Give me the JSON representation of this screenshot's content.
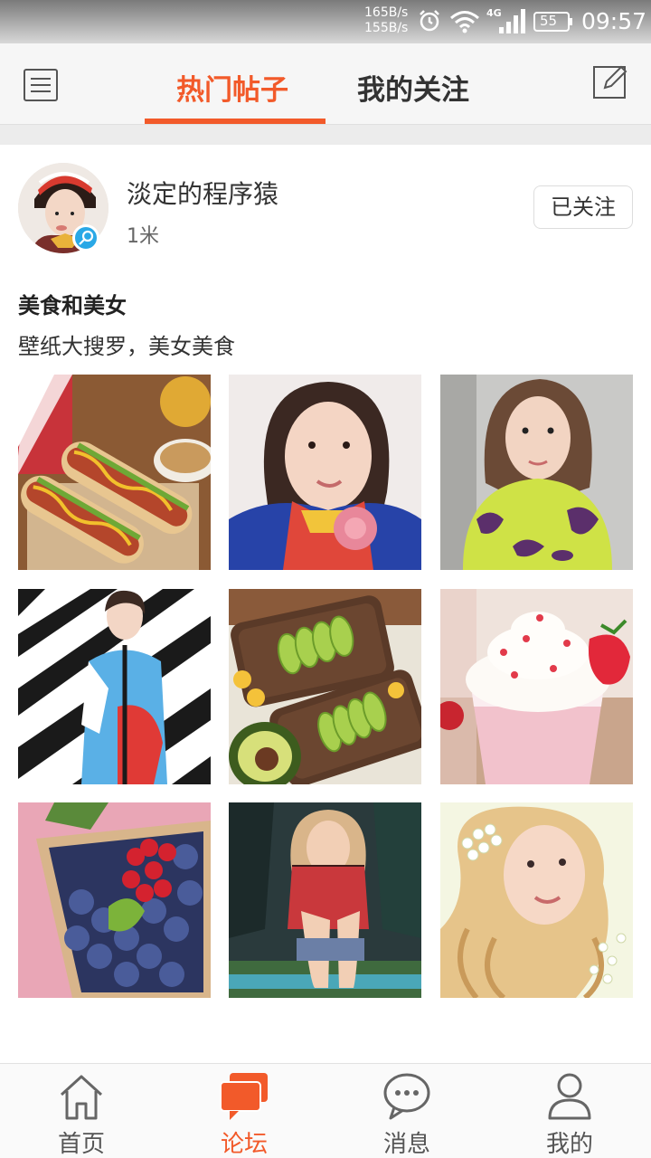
{
  "status_bar": {
    "net_up": "165B/s",
    "net_down": "155B/s",
    "network": "4G",
    "battery": "55",
    "time": "09:57"
  },
  "header": {
    "tabs": [
      {
        "label": "热门帖子",
        "active": true
      },
      {
        "label": "我的关注",
        "active": false
      }
    ],
    "accent_color": "#f25a2a"
  },
  "post": {
    "username": "淡定的程序猿",
    "distance": "1米",
    "follow_label": "已关注",
    "title": "美食和美女",
    "body": "壁纸大搜罗，美女美食",
    "images": [
      {
        "subject": "hot dogs"
      },
      {
        "subject": "woman with scarf"
      },
      {
        "subject": "woman in green dress"
      },
      {
        "subject": "woman in striped room"
      },
      {
        "subject": "avocado toast"
      },
      {
        "subject": "strawberry milkshake"
      },
      {
        "subject": "berries basket"
      },
      {
        "subject": "woman sitting"
      },
      {
        "subject": "woman with flowers"
      }
    ]
  },
  "bottom_nav": [
    {
      "label": "首页",
      "icon": "home-icon",
      "active": false
    },
    {
      "label": "论坛",
      "icon": "forum-icon",
      "active": true
    },
    {
      "label": "消息",
      "icon": "message-icon",
      "active": false
    },
    {
      "label": "我的",
      "icon": "profile-icon",
      "active": false
    }
  ]
}
